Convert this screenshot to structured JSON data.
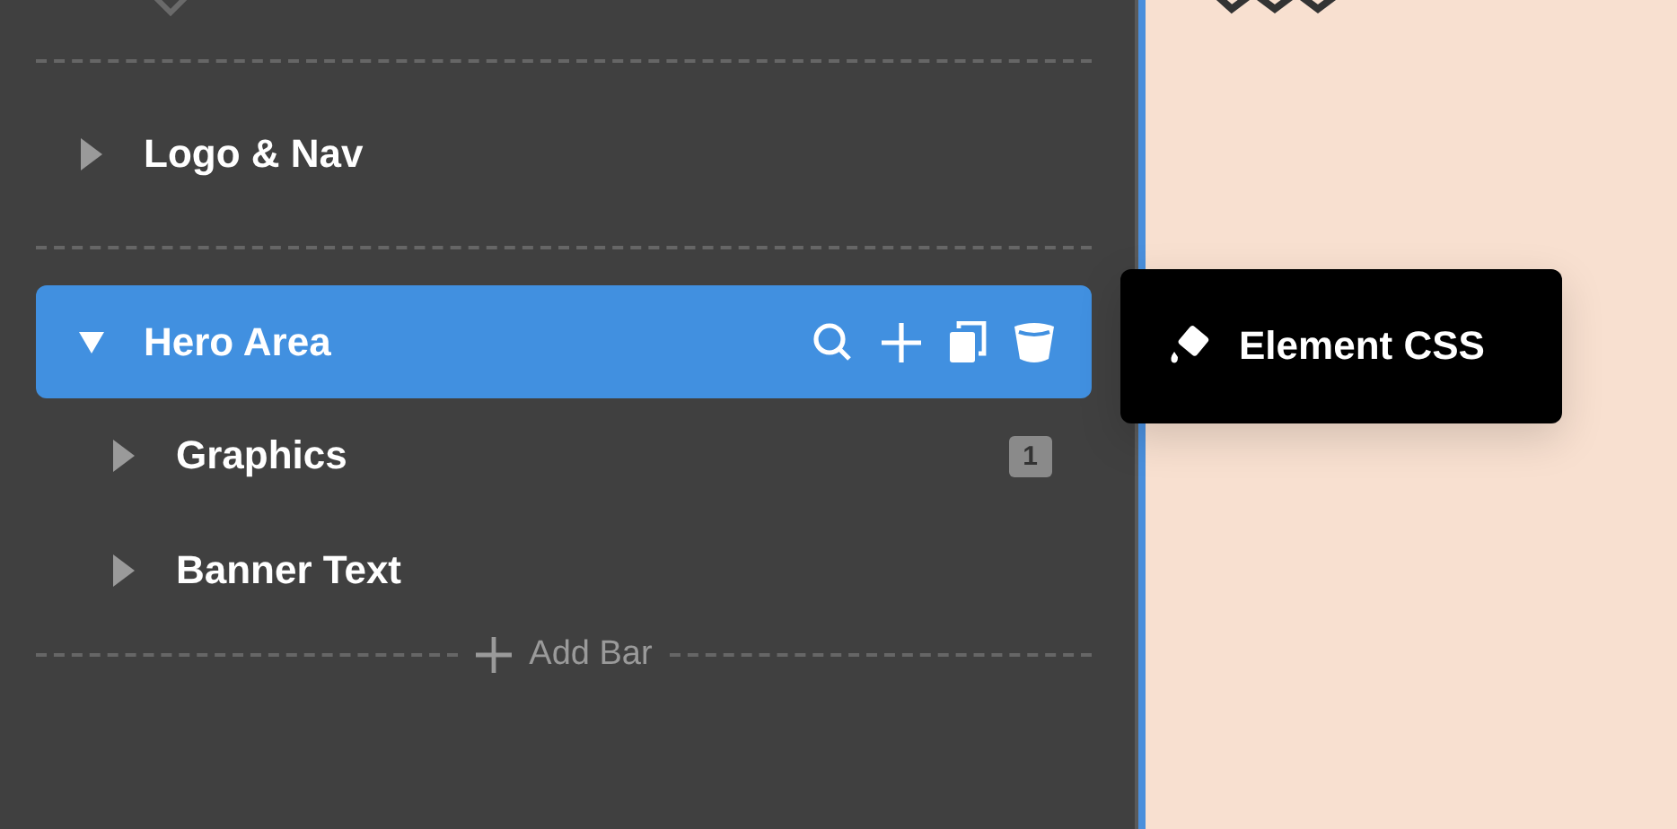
{
  "sections": [
    {
      "label": "Logo & Nav",
      "expanded": false,
      "selected": false
    },
    {
      "label": "Hero Area",
      "expanded": true,
      "selected": true,
      "children": [
        {
          "label": "Graphics",
          "expanded": false,
          "badge": "1"
        },
        {
          "label": "Banner Text",
          "expanded": false
        }
      ]
    }
  ],
  "add_bar": {
    "label": "Add Bar"
  },
  "tooltip": {
    "label": "Element CSS"
  }
}
